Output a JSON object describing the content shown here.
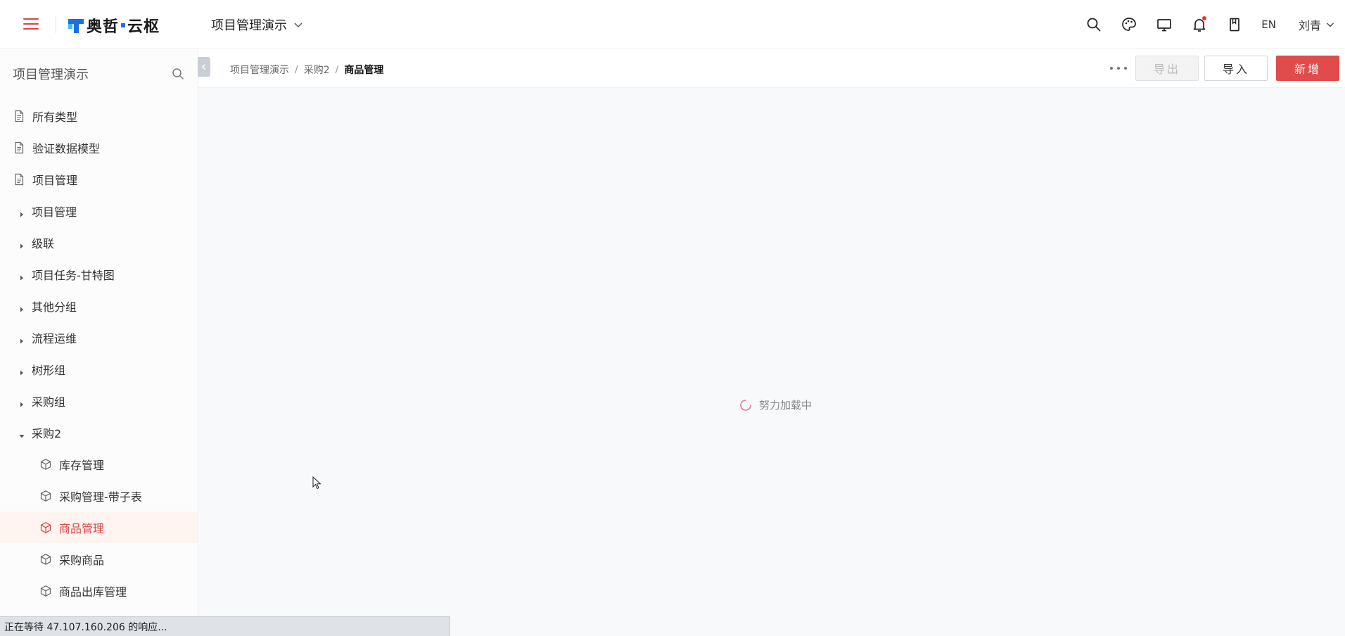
{
  "header": {
    "logo_text": "奥哲",
    "logo_text2": "云枢",
    "project_name": "项目管理演示",
    "lang": "EN",
    "user": "刘青",
    "icons": [
      "search-icon",
      "palette-icon",
      "monitor-icon",
      "bell-icon",
      "bookmark-icon"
    ],
    "colors": {
      "accent": "#d84545",
      "brand_blue": "#1a6fe8",
      "brand_cyan": "#39c0f0"
    }
  },
  "sidebar": {
    "title": "项目管理演示",
    "items": [
      {
        "label": "所有类型",
        "kind": "page"
      },
      {
        "label": "验证数据模型",
        "kind": "page"
      },
      {
        "label": "项目管理",
        "kind": "page"
      },
      {
        "label": "项目管理",
        "kind": "group",
        "expanded": false
      },
      {
        "label": "级联",
        "kind": "group",
        "expanded": false
      },
      {
        "label": "项目任务-甘特图",
        "kind": "group",
        "expanded": false
      },
      {
        "label": "其他分组",
        "kind": "group",
        "expanded": false
      },
      {
        "label": "流程运维",
        "kind": "group",
        "expanded": false
      },
      {
        "label": "树形组",
        "kind": "group",
        "expanded": false
      },
      {
        "label": "采购组",
        "kind": "group",
        "expanded": false
      },
      {
        "label": "采购2",
        "kind": "group",
        "expanded": true
      },
      {
        "label": "库存管理",
        "kind": "child"
      },
      {
        "label": "采购管理-带子表",
        "kind": "child"
      },
      {
        "label": "商品管理",
        "kind": "child",
        "active": true
      },
      {
        "label": "采购商品",
        "kind": "child"
      },
      {
        "label": "商品出库管理",
        "kind": "child"
      }
    ]
  },
  "breadcrumb": [
    "项目管理演示",
    "采购2",
    "商品管理"
  ],
  "toolbar": {
    "export_label": "导出",
    "import_label": "导入",
    "new_label": "新增"
  },
  "content": {
    "loading_text": "努力加载中"
  },
  "statusbar": {
    "text": "正在等待 47.107.160.206 的响应..."
  }
}
